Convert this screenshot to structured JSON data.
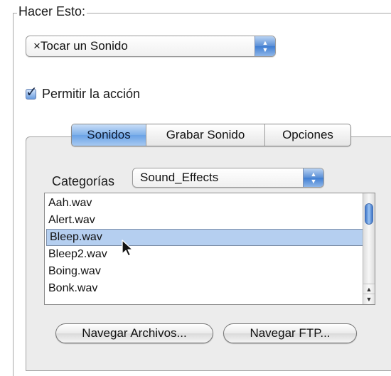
{
  "group": {
    "title": "Hacer Esto:"
  },
  "action_popup": {
    "value": "×Tocar un Sonido"
  },
  "allow_action": {
    "label": "Permitir la acción",
    "checked": true
  },
  "tabs": [
    {
      "label": "Sonidos",
      "selected": true
    },
    {
      "label": "Grabar Sonido",
      "selected": false
    },
    {
      "label": "Opciones",
      "selected": false
    }
  ],
  "category": {
    "label": "Categorías",
    "value": "Sound_Effects"
  },
  "sound_list": {
    "items": [
      "Aah.wav",
      "Alert.wav",
      "Bleep.wav",
      "Bleep2.wav",
      "Boing.wav",
      "Bonk.wav"
    ],
    "selected": "Bleep.wav"
  },
  "buttons": {
    "browse_files": "Navegar Archivos...",
    "browse_ftp": "Navegar FTP..."
  },
  "icons": {
    "popup_arrows": "up-down-arrows-icon",
    "checkmark": "checkmark-icon",
    "cursor": "mouse-pointer-icon"
  }
}
